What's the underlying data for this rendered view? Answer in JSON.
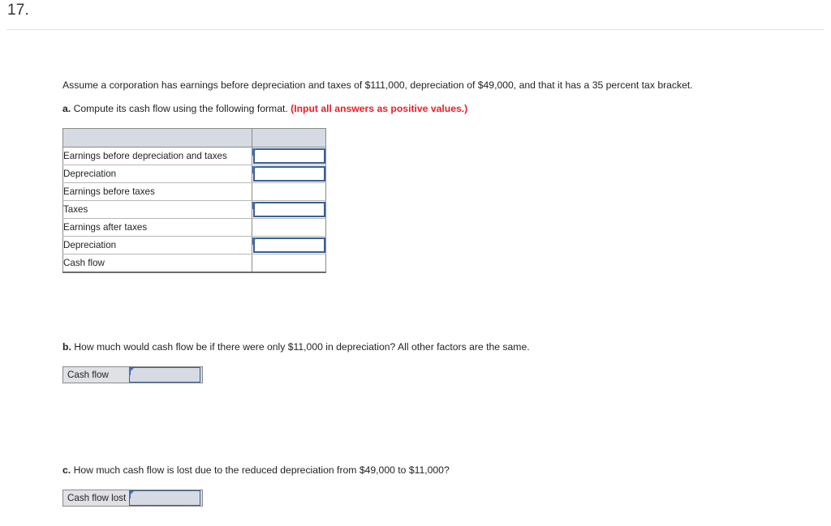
{
  "question": {
    "number": "17."
  },
  "intro": "Assume a corporation has earnings before depreciation and taxes of $111,000, depreciation of $49,000, and that it has a 35 percent tax bracket.",
  "parts": {
    "a": {
      "label": "a.",
      "text": "Compute its cash flow using the following format.",
      "hint": "(Input all answers as positive values.)",
      "hint_color": "#ee1c25",
      "table": {
        "header": [
          "",
          ""
        ],
        "rows": [
          {
            "label": "Earnings before depreciation and taxes",
            "value": "",
            "input": true
          },
          {
            "label": "Depreciation",
            "value": "",
            "input": true
          },
          {
            "label": "Earnings before taxes",
            "value": "",
            "input": false
          },
          {
            "label": "Taxes",
            "value": "",
            "input": true
          },
          {
            "label": "Earnings after taxes",
            "value": "",
            "input": false
          },
          {
            "label": "Depreciation",
            "value": "",
            "input": true
          },
          {
            "label": "Cash flow",
            "value": "",
            "input": false
          }
        ]
      }
    },
    "b": {
      "label": "b.",
      "text": "How much would cash flow be if there were only $11,000 in depreciation? All other factors are the same.",
      "field_label": "Cash flow",
      "field_value": ""
    },
    "c": {
      "label": "c.",
      "text": "How much cash flow is lost due to the reduced depreciation from $49,000 to $11,000?",
      "field_label": "Cash flow lost",
      "field_value": ""
    }
  },
  "colors": {
    "header_fill": "#d5dae3",
    "input_border": "#3a5f92",
    "flag": "#3f6fb5",
    "hint_red": "#ee1c25",
    "rule": "#e3e3e3"
  }
}
